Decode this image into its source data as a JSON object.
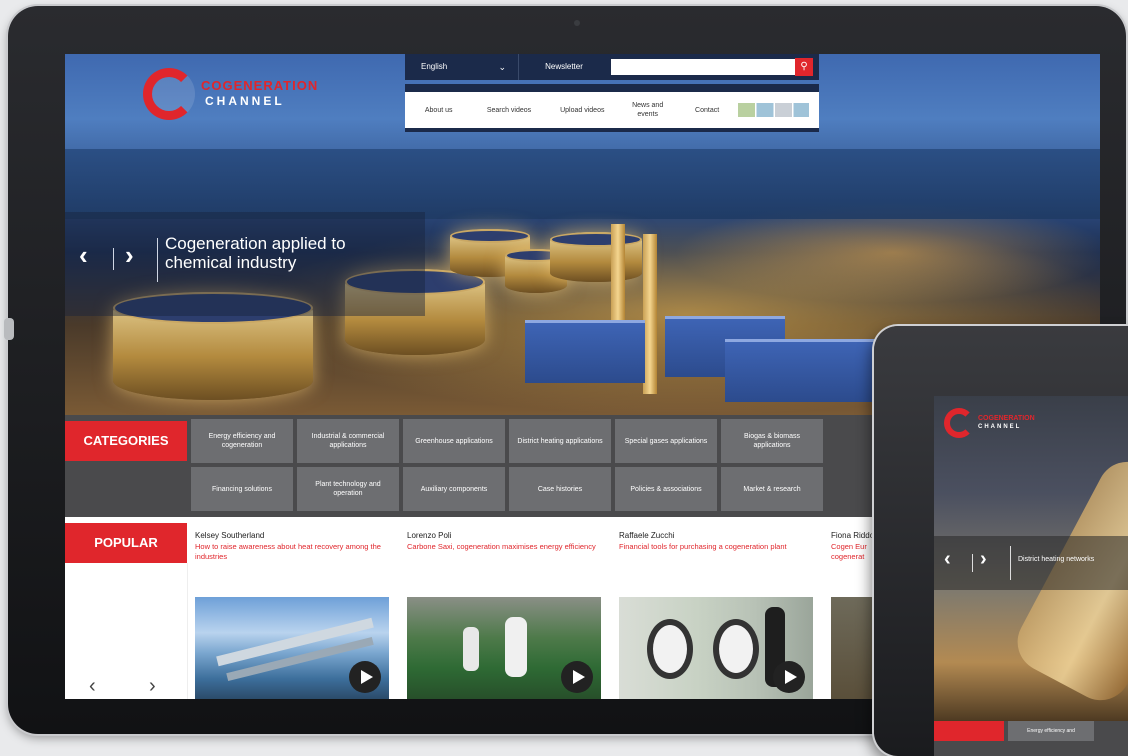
{
  "logo": {
    "line1": "COGENERATION",
    "line2": "CHANNEL"
  },
  "topbar": {
    "language": "English",
    "newsletter": "Newsletter",
    "search_placeholder": ""
  },
  "nav": [
    "About us",
    "Search videos",
    "Upload videos",
    "News and events",
    "Contact"
  ],
  "slider": {
    "title": "Cogeneration applied to chemical industry"
  },
  "categories": {
    "label": "CATEGORIES",
    "row1": [
      "Energy efficiency and cogeneration",
      "Industrial & commercial applications",
      "Greenhouse applications",
      "District heating applications",
      "Special gases applications",
      "Biogas & biomass applications"
    ],
    "row2": [
      "Financing solutions",
      "Plant technology and operation",
      "Auxiliary components",
      "Case histories",
      "Policies & associations",
      "Market & research"
    ]
  },
  "popular": {
    "label": "POPULAR",
    "items": [
      {
        "author": "Kelsey Southerland",
        "title": "How to raise awareness about heat recovery among the industries"
      },
      {
        "author": "Lorenzo Poli",
        "title": "Carbone Saxi, cogeneration maximises energy efficiency"
      },
      {
        "author": "Raffaele Zucchi",
        "title": "Financial tools for purchasing a cogeneration plant"
      },
      {
        "author": "Fiona Riddo",
        "title": "Cogen Eur cogenerat"
      }
    ]
  },
  "tablet": {
    "logo_line1": "COGENERATION",
    "logo_line2": "CHANNEL",
    "caption": "District heating networks",
    "cat1": "Energy efficiency and"
  },
  "colors": {
    "accent": "#e0262c",
    "category_bg": "#4a4a4c",
    "category_tile": "#6d6e71",
    "nav_dark": "#1b2a4a"
  }
}
